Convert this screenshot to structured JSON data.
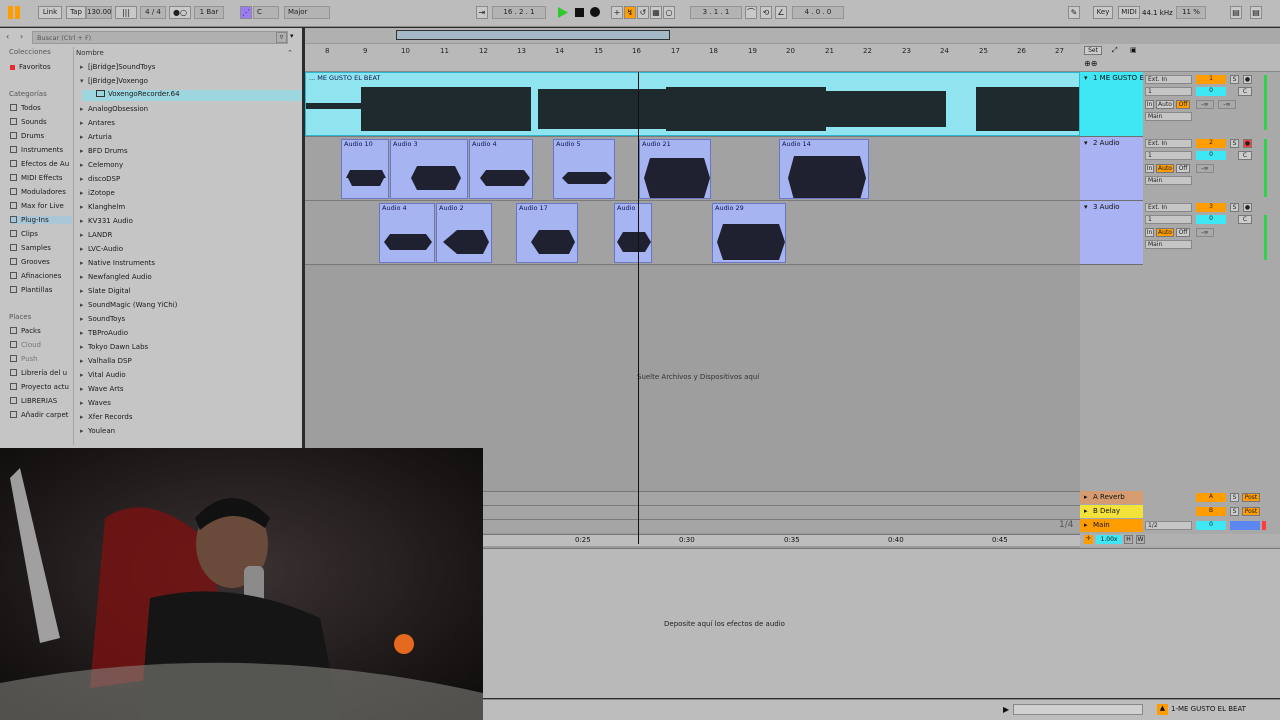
{
  "transport": {
    "link": "Link",
    "tap": "Tap",
    "tempo": "130.00",
    "signature": "4 / 4",
    "quantize": "1 Bar",
    "key": "C",
    "scale": "Major",
    "position": "16 .  2 .  1",
    "loop_start": "3 .  1 .  1",
    "loop_length": "4 .  0 .  0",
    "key_label": "Key",
    "midi_label": "MIDI",
    "sample_rate": "44.1 kHz",
    "cpu": "11 %"
  },
  "browser": {
    "search_placeholder": "Buscar (Ctrl + F)",
    "headers": {
      "collections": "Colecciones",
      "categories": "Categorías",
      "places": "Places",
      "name": "Nombre"
    },
    "collections": [
      "Favoritos"
    ],
    "categories": [
      "Todos",
      "Sounds",
      "Drums",
      "Instruments",
      "Efectos de Au",
      "MIDI Effects",
      "Moduladores",
      "Max for Live",
      "Plug-Ins",
      "Clips",
      "Samples",
      "Grooves",
      "Afinaciones",
      "Plantillas"
    ],
    "places": [
      "Packs",
      "Cloud",
      "Push",
      "Librería del u",
      "Proyecto actu",
      "LIBRERIAS",
      "Añadir carpet"
    ],
    "items": [
      "[jBridge]SoundToys",
      "[jBridge]Voxengo",
      "VoxengoRecorder.64",
      "AnalogObsession",
      "Antares",
      "Arturia",
      "BFD Drums",
      "Celemony",
      "discoDSP",
      "iZotope",
      "Klanghelm",
      "KV331 Audio",
      "LANDR",
      "LVC-Audio",
      "Native Instruments",
      "Newfangled Audio",
      "Slate Digital",
      "SoundMagic (Wang YiChi)",
      "SoundToys",
      "TBProAudio",
      "Tokyo Dawn Labs",
      "Valhalla DSP",
      "Vital Audio",
      "Wave Arts",
      "Waves",
      "Xfer Records",
      "Youlean"
    ]
  },
  "ruler": {
    "bars": [
      "8",
      "9",
      "10",
      "11",
      "12",
      "13",
      "14",
      "15",
      "16",
      "17",
      "18",
      "19",
      "20",
      "21",
      "22",
      "23",
      "24",
      "25",
      "26",
      "27"
    ],
    "set_label": "Set",
    "time_labels": [
      "0:25",
      "0:30",
      "0:35",
      "0:40",
      "0:45"
    ]
  },
  "tracks": [
    {
      "name": "1 ME GUSTO E",
      "number": "1",
      "input": "Ext. In",
      "channel": "1",
      "output": "Main",
      "volume": "0",
      "pan": "C"
    },
    {
      "name": "2 Audio",
      "number": "2",
      "input": "Ext. In",
      "channel": "1",
      "output": "Main",
      "volume": "0",
      "pan": "C"
    },
    {
      "name": "3 Audio",
      "number": "3",
      "input": "Ext. In",
      "channel": "1",
      "output": "Main",
      "volume": "0",
      "pan": "C"
    }
  ],
  "monitor": {
    "in": "In",
    "auto": "Auto",
    "off": "Off",
    "minus_inf": "-∞"
  },
  "clips": {
    "beat": "... ME GUSTO EL BEAT",
    "track2": [
      "Audio 10",
      "Audio 3",
      "Audio 4",
      "Audio 5",
      "Audio 21",
      "Audio 14"
    ],
    "track3": [
      "Audio 4",
      "Audio 2",
      "Audio 17",
      "Audio",
      "Audio 29"
    ]
  },
  "drop_hint": "Suelte Archivos y Dispositivos aquí",
  "returns": [
    {
      "name": "A Reverb",
      "letter": "A",
      "send": "S",
      "post": "Post"
    },
    {
      "name": "B Delay",
      "letter": "B",
      "send": "S",
      "post": "Post"
    }
  ],
  "main": {
    "name": "Main",
    "routing": "1/2",
    "volume": "0",
    "fraction": "1/4"
  },
  "zoom": "1.00x",
  "detail_hint": "Deposite aquí los efectos de audio",
  "bottom_track": "1-ME GUSTO EL BEAT",
  "colors": {
    "accent": "#ff9c00",
    "clip_blue": "#a7b4f2",
    "clip_cyan": "#8fe4f0",
    "play": "#2ec92e",
    "arm": "#ff3b3b"
  }
}
